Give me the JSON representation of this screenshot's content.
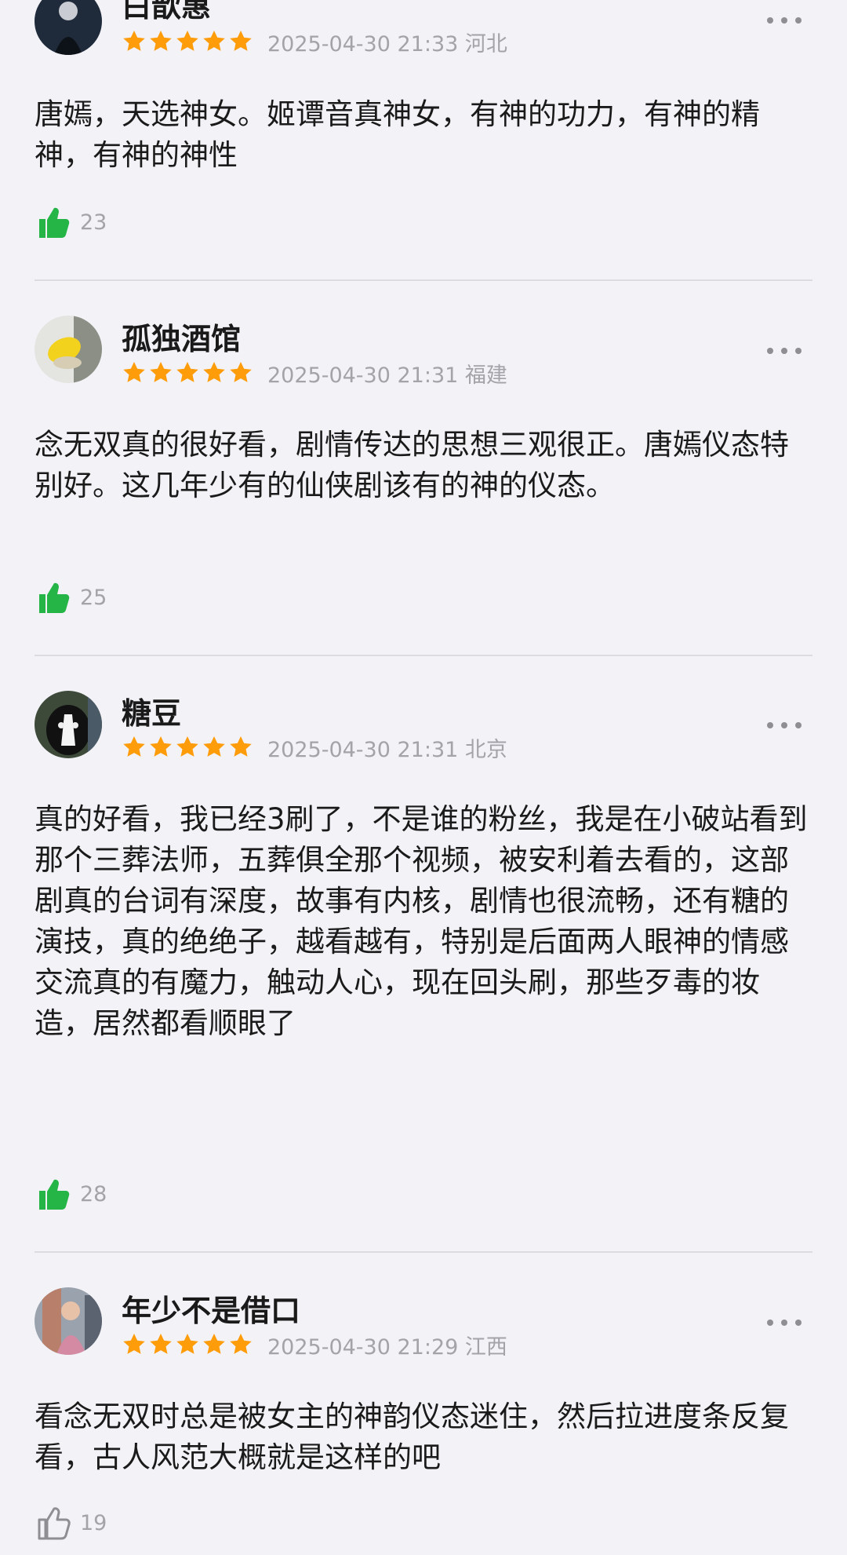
{
  "colors": {
    "background": "#f2f2f7",
    "star": "#ff9c0a",
    "like_active": "#25b546",
    "meta_text": "#a3a3a8"
  },
  "reviews": [
    {
      "username": "白歆惠",
      "stars": 5,
      "meta": "2025-04-30 21:33 河北",
      "content": "唐嫣，天选神女。姬谭音真神女，有神的功力，有神的精神，有神的神性",
      "likes": "23",
      "liked": true
    },
    {
      "username": "孤独酒馆",
      "stars": 5,
      "meta": "2025-04-30 21:31 福建",
      "content": "念无双真的很好看，剧情传达的思想三观很正。唐嫣仪态特别好。这几年少有的仙侠剧该有的神的仪态。",
      "likes": "25",
      "liked": true
    },
    {
      "username": "糖豆",
      "stars": 5,
      "meta": "2025-04-30 21:31 北京",
      "content": "真的好看，我已经3刷了，不是谁的粉丝，我是在小破站看到那个三葬法师，五葬俱全那个视频，被安利着去看的，这部剧真的台词有深度，故事有内核，剧情也很流畅，还有糖的演技，真的绝绝子，越看越有，特别是后面两人眼神的情感交流真的有魔力，触动人心，现在回头刷，那些歹毒的妆造，居然都看顺眼了",
      "likes": "28",
      "liked": true
    },
    {
      "username": "年少不是借口",
      "stars": 5,
      "meta": "2025-04-30 21:29 江西",
      "content": "看念无双时总是被女主的神韵仪态迷住，然后拉进度条反复看，古人风范大概就是这样的吧",
      "likes": "19",
      "liked": false
    }
  ]
}
